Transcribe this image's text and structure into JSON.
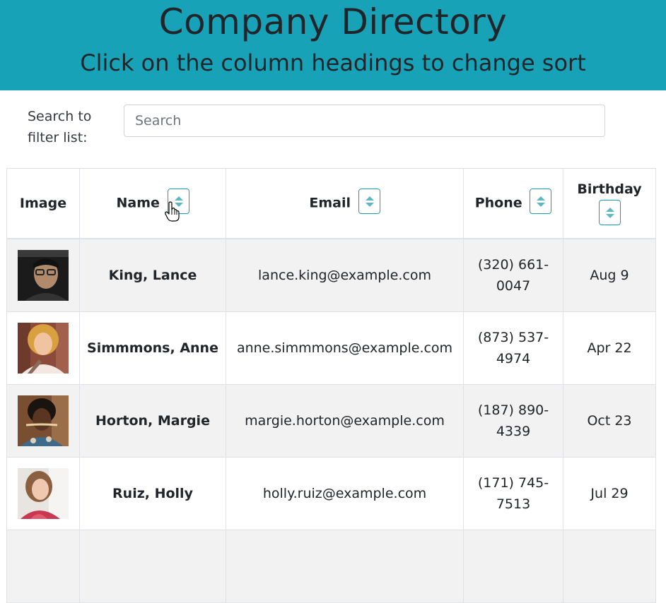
{
  "header": {
    "title": "Company Directory",
    "subtitle": "Click on the column headings to change sort"
  },
  "search": {
    "label": "Search to filter list:",
    "placeholder": "Search",
    "value": ""
  },
  "table": {
    "columns": {
      "image": "Image",
      "name": "Name",
      "email": "Email",
      "phone": "Phone",
      "birthday": "Birthday"
    },
    "sort_icon": "sort-icon",
    "rows": [
      {
        "name": "King, Lance",
        "email": "lance.king@example.com",
        "phone_1": "(320) 661-",
        "phone_2": "0047",
        "birthday": "Aug 9"
      },
      {
        "name": "Simmmons, Anne",
        "email": "anne.simmmons@example.com",
        "phone_1": "(873) 537-",
        "phone_2": "4974",
        "birthday": "Apr 22"
      },
      {
        "name": "Horton, Margie",
        "email": "margie.horton@example.com",
        "phone_1": "(187) 890-",
        "phone_2": "4339",
        "birthday": "Oct 23"
      },
      {
        "name": "Ruiz, Holly",
        "email": "holly.ruiz@example.com",
        "phone_1": "(171) 745-",
        "phone_2": "7513",
        "birthday": "Jul 29"
      }
    ]
  },
  "colors": {
    "header_bg": "#17a2b8",
    "row_stripe": "#f2f2f2",
    "sort_button_border": "#17a2b8"
  }
}
